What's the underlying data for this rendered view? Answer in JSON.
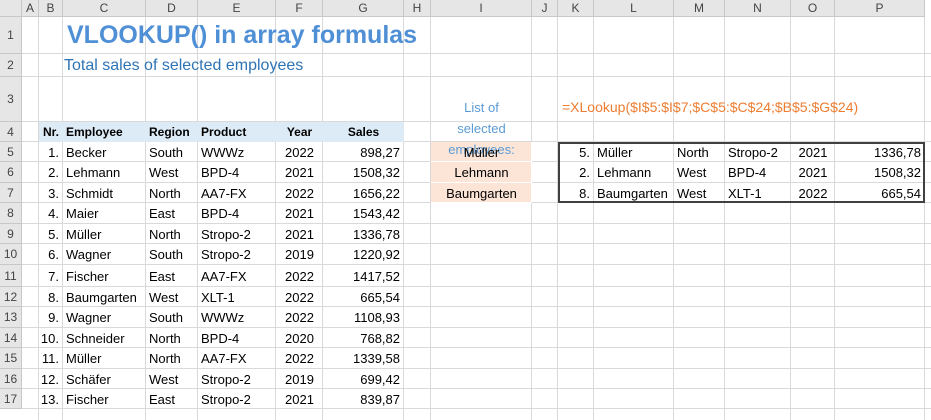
{
  "columns": [
    "A",
    "B",
    "C",
    "D",
    "E",
    "F",
    "G",
    "H",
    "I",
    "J",
    "K",
    "L",
    "M",
    "N",
    "O",
    "P"
  ],
  "rows": [
    "1",
    "2",
    "3",
    "4",
    "5",
    "6",
    "7",
    "8",
    "9",
    "10",
    "11",
    "12",
    "13",
    "14",
    "15",
    "16",
    "17"
  ],
  "title": "VLOOKUP() in array formulas",
  "subtitle": "Total sales of selected employees",
  "list_label": [
    "List of",
    "selected",
    "employees:"
  ],
  "formula": "=XLookup($I$5:$I$7;$C$5:$C$24;$B$5:$G$24)",
  "headers": [
    "Nr.",
    "Employee",
    "Region",
    "Product",
    "Year",
    "Sales"
  ],
  "table": [
    [
      "1.",
      "Becker",
      "South",
      "WWWz",
      "2022",
      "898,27"
    ],
    [
      "2.",
      "Lehmann",
      "West",
      "BPD-4",
      "2021",
      "1508,32"
    ],
    [
      "3.",
      "Schmidt",
      "North",
      "AA7-FX",
      "2022",
      "1656,22"
    ],
    [
      "4.",
      "Maier",
      "East",
      "BPD-4",
      "2021",
      "1543,42"
    ],
    [
      "5.",
      "Müller",
      "North",
      "Stropo-2",
      "2021",
      "1336,78"
    ],
    [
      "6.",
      "Wagner",
      "South",
      "Stropo-2",
      "2019",
      "1220,92"
    ],
    [
      "7.",
      "Fischer",
      "East",
      "AA7-FX",
      "2022",
      "1417,52"
    ],
    [
      "8.",
      "Baumgarten",
      "West",
      "XLT-1",
      "2022",
      "665,54"
    ],
    [
      "9.",
      "Wagner",
      "South",
      "WWWz",
      "2022",
      "1108,93"
    ],
    [
      "10.",
      "Schneider",
      "North",
      "BPD-4",
      "2020",
      "768,82"
    ],
    [
      "11.",
      "Müller",
      "North",
      "AA7-FX",
      "2022",
      "1339,58"
    ],
    [
      "12.",
      "Schäfer",
      "West",
      "Stropo-2",
      "2019",
      "699,42"
    ],
    [
      "13.",
      "Fischer",
      "East",
      "Stropo-2",
      "2021",
      "839,87"
    ]
  ],
  "selected": [
    "Müller",
    "Lehmann",
    "Baumgarten"
  ],
  "results": [
    [
      "5.",
      "Müller",
      "North",
      "Stropo-2",
      "2021",
      "1336,78"
    ],
    [
      "2.",
      "Lehmann",
      "West",
      "BPD-4",
      "2021",
      "1508,32"
    ],
    [
      "8.",
      "Baumgarten",
      "West",
      "XLT-1",
      "2022",
      "665,54"
    ]
  ],
  "colors": {
    "title": "#4f8fd6",
    "subtitle": "#2e74b5",
    "list_label": "#5b9bd5",
    "formula": "#ed7d31",
    "header_fill": "#ddebf7",
    "selected_fill": "#fce4d6"
  }
}
